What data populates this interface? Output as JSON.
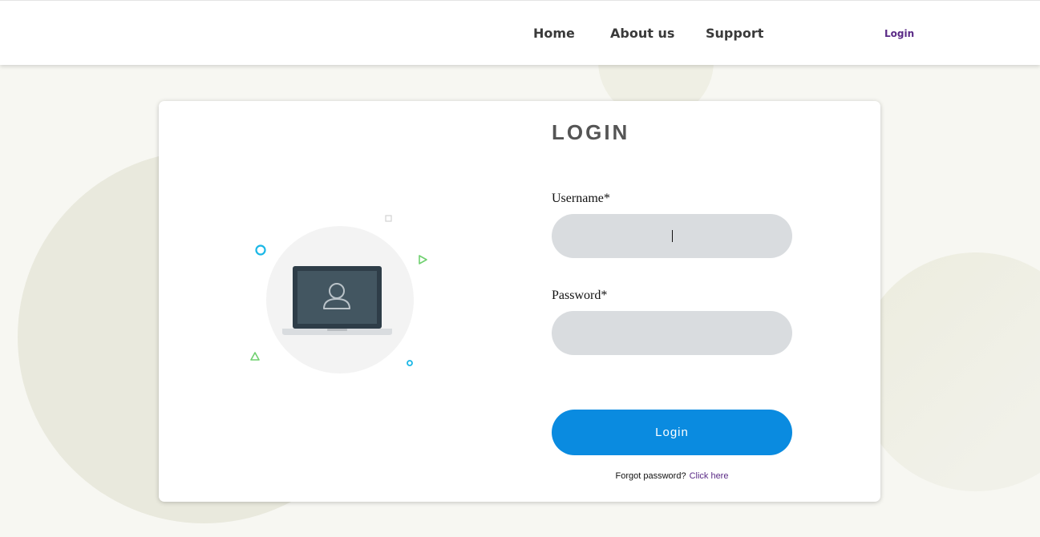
{
  "nav": {
    "home": "Home",
    "about": "About us",
    "support": "Support",
    "login": "Login"
  },
  "form": {
    "title": "LOGIN",
    "username_label": "Username*",
    "username_value": "",
    "password_label": "Password*",
    "password_value": "",
    "submit_label": "Login",
    "forgot_text": "Forgot password?",
    "forgot_link": "Click here"
  },
  "illustration": {
    "icon": "laptop-user-icon"
  },
  "colors": {
    "primary": "#0a8be0",
    "link": "#5a2a86",
    "input_bg": "#d9dcdf",
    "page_bg": "#f7f7f2"
  }
}
